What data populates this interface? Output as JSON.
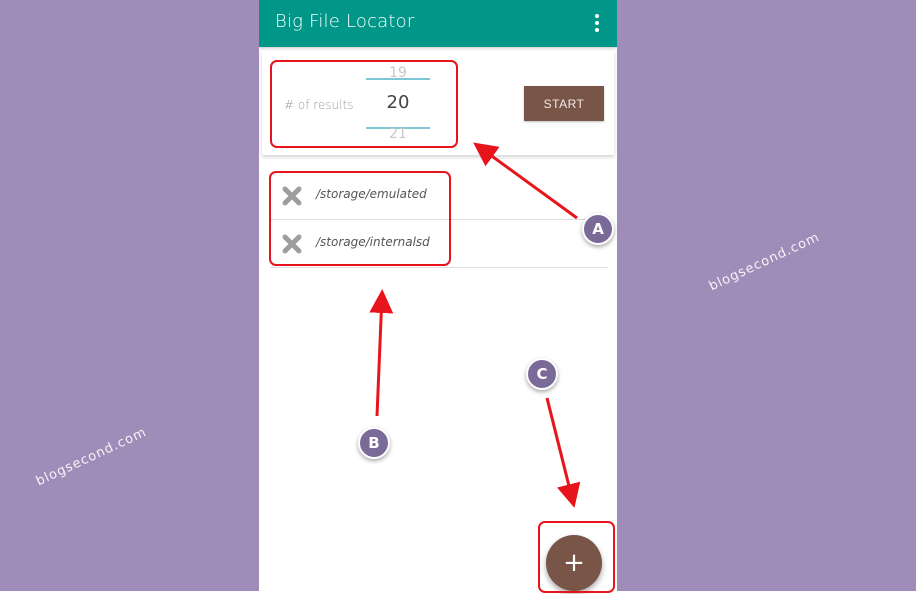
{
  "app": {
    "title": "Big File Locator",
    "overflow_menu_icon": "more-vert-icon"
  },
  "results_picker": {
    "label": "# of results",
    "previous": "19",
    "current": "20",
    "next": "21"
  },
  "start_button": {
    "label": "START"
  },
  "paths": [
    {
      "path": "/storage/emulated",
      "remove_icon": "close-icon"
    },
    {
      "path": "/storage/internalsd",
      "remove_icon": "close-icon"
    }
  ],
  "fab": {
    "label": "+",
    "icon": "add-icon"
  },
  "annotations": {
    "callouts": [
      "A",
      "B",
      "C"
    ],
    "watermark": "blogsecond.com"
  },
  "colors": {
    "background": "#a08cb8",
    "appbar": "#009688",
    "accent_brown": "#795548",
    "picker_divider": "#7fc6d6",
    "highlight_red": "#e8141c",
    "callout_fill": "#7a6a98"
  }
}
